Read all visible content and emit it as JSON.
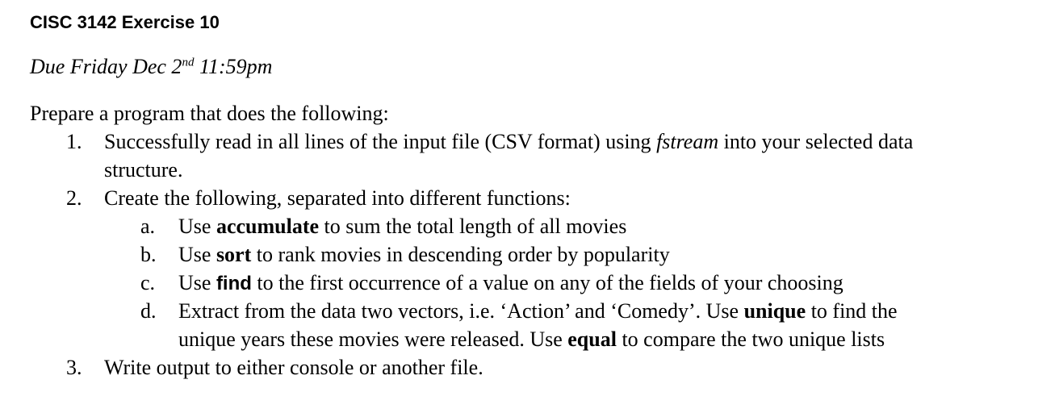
{
  "title": "CISC 3142 Exercise 10",
  "due": {
    "before": "Due Friday Dec 2",
    "sup": "nd",
    "after": " 11:59pm"
  },
  "intro": "Prepare a program that does the following:",
  "items": [
    {
      "number": "1.",
      "line1_before": "Successfully read in all lines of the input file (CSV format) using ",
      "line1_emph": "fstream",
      "line1_after": " into your selected data",
      "line2": "structure."
    },
    {
      "number": "2.",
      "text": "Create the following, separated into different functions:",
      "subitems": [
        {
          "letter": "a.",
          "before": "Use ",
          "keyword": "accumulate",
          "after": " to sum the total length of all movies"
        },
        {
          "letter": "b.",
          "before": "Use ",
          "keyword": "sort",
          "after": " to rank movies in descending order by popularity"
        },
        {
          "letter": "c.",
          "before": "Use ",
          "keyword": "find",
          "after": " to the first occurrence of a value on any of the fields of your choosing"
        },
        {
          "letter": "d.",
          "line1_before": "Extract from the data two vectors, i.e. ‘Action’ and ‘Comedy’. Use ",
          "keyword1": "unique",
          "line1_after": " to find the",
          "line2_before": "unique years these movies were released. Use ",
          "keyword2": "equal",
          "line2_after": " to compare the two unique lists"
        }
      ]
    },
    {
      "number": "3.",
      "text": "Write output to either console or another file."
    }
  ]
}
